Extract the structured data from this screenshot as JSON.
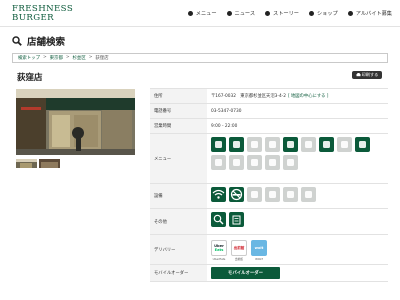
{
  "header": {
    "logo_line1": "FRESHNESS",
    "logo_line2": "BURGER",
    "nav": [
      {
        "icon": "home-icon",
        "label": "メニュー"
      },
      {
        "icon": "news-icon",
        "label": "ニュース"
      },
      {
        "icon": "book-icon",
        "label": "ストーリー"
      },
      {
        "icon": "location-pin-icon",
        "label": "ショップ"
      },
      {
        "icon": "person-icon",
        "label": "アルバイト募集"
      }
    ]
  },
  "page": {
    "title": "店舗検索"
  },
  "breadcrumb": [
    "検索トップ",
    "東京都",
    "杉並区",
    "荻窪店"
  ],
  "store": {
    "name": "荻窪店",
    "print_label": "印刷する",
    "rows": {
      "address_label": "住所",
      "address_value": "〒167-0032　東京都杉並区天沼3-4-2",
      "address_link": "[ 地図の中心にする ]",
      "phone_label": "電話番号",
      "phone_value": "03-5347-0730",
      "hours_label": "営業時間",
      "hours_value": "9:00 - 22:00",
      "menu_label": "メニュー",
      "facilities_label": "設備",
      "other_label": "その他",
      "delivery_label": "デリバリー",
      "mobile_order_label": "モバイルオーダー"
    },
    "menu_icons": [
      {
        "name": "breakfast-icon",
        "active": true
      },
      {
        "name": "morning-set-icon",
        "active": true
      },
      {
        "name": "drink-icon",
        "active": false
      },
      {
        "name": "bottle-icon",
        "active": false
      },
      {
        "name": "coffee-icon",
        "active": true
      },
      {
        "name": "set-menu-icon",
        "active": false
      },
      {
        "name": "cup-icon",
        "active": true
      },
      {
        "name": "sandwich-icon",
        "active": false
      },
      {
        "name": "cafe-icon",
        "active": true
      },
      {
        "name": "wine-icon",
        "active": false
      },
      {
        "name": "beer-icon",
        "active": false
      },
      {
        "name": "meal-icon",
        "active": false
      },
      {
        "name": "bowl-icon",
        "active": false
      },
      {
        "name": "dessert-icon",
        "active": false
      }
    ],
    "facility_icons": [
      {
        "name": "wifi-icon",
        "active": true
      },
      {
        "name": "no-smoking-icon",
        "active": true
      },
      {
        "name": "credit-card-icon",
        "active": false
      },
      {
        "name": "electronic-money-icon",
        "active": false
      },
      {
        "name": "barcode-payment-icon",
        "active": false
      },
      {
        "name": "power-outlet-icon",
        "active": false
      }
    ],
    "other_icons": [
      {
        "name": "store-search-icon",
        "active": true
      },
      {
        "name": "takeout-icon",
        "active": true
      }
    ],
    "delivery": [
      {
        "logo_line1": "Uber",
        "logo_line2": "Eats",
        "caption": "UberEats",
        "bg": "#ffffff",
        "fg": "#142328"
      },
      {
        "logo_line1": "出前館",
        "logo_line2": "",
        "caption": "出前館",
        "bg": "#ffffff",
        "fg": "#d0202a"
      },
      {
        "logo_line1": "wolt",
        "logo_line2": "",
        "caption": "WOLT",
        "bg": "#6ab7e3",
        "fg": "#ffffff"
      }
    ],
    "mobile_order_button": "モバイルオーダー"
  },
  "colors": {
    "brand_green": "#0b5a3a"
  }
}
